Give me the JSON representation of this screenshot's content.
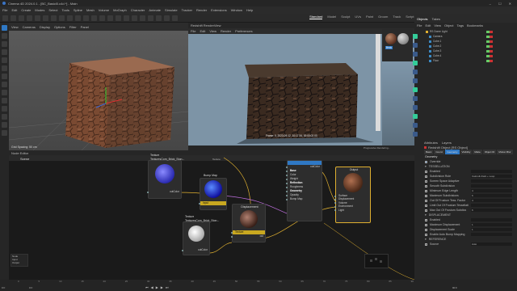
{
  "app": {
    "title": "Cinema 4D 2024.0.1 - [BC_Basicl0.c4d *] - Main"
  },
  "menu": [
    "File",
    "Edit",
    "Create",
    "Modes",
    "Select",
    "Tools",
    "Spline",
    "Mesh",
    "Volume",
    "MoGraph",
    "Character",
    "Animate",
    "Simulate",
    "Tracker",
    "Render",
    "Extensions",
    "Window",
    "Help"
  ],
  "layouts": {
    "items": [
      "Standard",
      "Model",
      "Sculpt",
      "UVs",
      "Paint",
      "Groom",
      "Track",
      "Script",
      "Nodes"
    ],
    "active": "Standard"
  },
  "tab_label": "BC_Basicl0.c4d *",
  "viewport1": {
    "menus": [
      "View",
      "Cameras",
      "Display",
      "Options",
      "Filter",
      "Panel"
    ],
    "name": "Perspective",
    "camera": "Default Camera",
    "footer": "Grid Spacing: 50 cm"
  },
  "viewport2": {
    "menus": [
      "File",
      "Edit",
      "View",
      "Render",
      "Preferences"
    ],
    "title": "Redshift RenderView",
    "footer": "Frame: 0, 2023-09-12, 10:17:34, 00:00:02.00",
    "progress": "Progressive Rendering..."
  },
  "node_editor": {
    "title": "Node Editor",
    "tab": "Scene",
    "nodes": {
      "tex1": {
        "label": "Texture",
        "name": "TexturesCom_Brick_Ston...",
        "ports": [
          "outColor"
        ]
      },
      "bump": {
        "label": "Bump Map",
        "ports": [
          "Input"
        ]
      },
      "std": {
        "label": "Standard",
        "sections": [
          "Base",
          "Color",
          "Weight",
          "Reflection",
          "Roughness",
          "Geometry",
          "Opacity",
          "Bump Map"
        ],
        "out": "outColor"
      },
      "output": {
        "label": "Output",
        "ports": [
          "Surface",
          "Displacement",
          "Volume",
          "Environment",
          "Light"
        ]
      },
      "tex2": {
        "label": "Texture",
        "name": "TexturesCom_Brick_Ston...",
        "ports": [
          "outColor"
        ]
      },
      "disp": {
        "label": "Displacement",
        "ports": [
          "Texture"
        ],
        "out": "out"
      },
      "tex_small": {
        "label": "Texture"
      }
    },
    "mini": {
      "node_label": "Node",
      "items": [
        "Input",
        "Output"
      ]
    }
  },
  "objects": {
    "tabs": [
      "Objects",
      "Takes"
    ],
    "menu": [
      "File",
      "Edit",
      "View",
      "Object",
      "Tags",
      "Bookmarks"
    ],
    "items": [
      "RS Dome Light",
      "Camera",
      "Cube.1",
      "Cube.2",
      "Cube.3",
      "Cube.4",
      "Floor"
    ]
  },
  "materials": {
    "name": "Brick"
  },
  "attributes": {
    "tabs": [
      "Attributes",
      "Layers"
    ],
    "header": "Redshift Object [RS Object]",
    "subtabs": [
      "Basic",
      "Coord.",
      "Geometry",
      "Visibility",
      "Matte",
      "Object ID",
      "Motion Blur"
    ],
    "active_subtab": "Geometry",
    "section": "Geometry",
    "override_label": "Override",
    "tess_header": "TESSELLATION",
    "tess_rows": [
      {
        "label": "Enabled",
        "value": ""
      },
      {
        "label": "Subdivision Rule",
        "value": "Catmull-Clark + Loop"
      },
      {
        "label": "Screen Space Adaptive",
        "value": ""
      },
      {
        "label": "Smooth Subdivision",
        "value": ""
      },
      {
        "label": "Minimum Edge Length",
        "value": "4"
      },
      {
        "label": "Maximum Subdivisions",
        "value": "6"
      },
      {
        "label": "Out Of Frustum Tess. Factor",
        "value": "4"
      },
      {
        "label": "Limit Out Of Frustum Tessellation",
        "value": ""
      },
      {
        "label": "Max Out Of Frustum Subdivs",
        "value": "6"
      }
    ],
    "disp_header": "DISPLACEMENT",
    "disp_rows": [
      {
        "label": "Enabled",
        "value": ""
      },
      {
        "label": "Maximum Displacement",
        "value": "1"
      },
      {
        "label": "Displacement Scale",
        "value": "1"
      },
      {
        "label": "Enable Auto Bump Mapping",
        "value": ""
      }
    ],
    "ref_header": "REFERENCE",
    "ref_rows": [
      {
        "label": "Source",
        "value": "Auto"
      }
    ]
  },
  "timeline": {
    "start": "0 F",
    "end": "90 F",
    "current": "0 F",
    "ruler": [
      "0",
      "5",
      "10",
      "15",
      "20",
      "25",
      "30",
      "35",
      "40",
      "45",
      "50",
      "55",
      "60",
      "65",
      "70",
      "75",
      "80",
      "85",
      "90"
    ]
  },
  "colors": {
    "accent": "#2f78c4",
    "bg": "#1e1e1e"
  }
}
